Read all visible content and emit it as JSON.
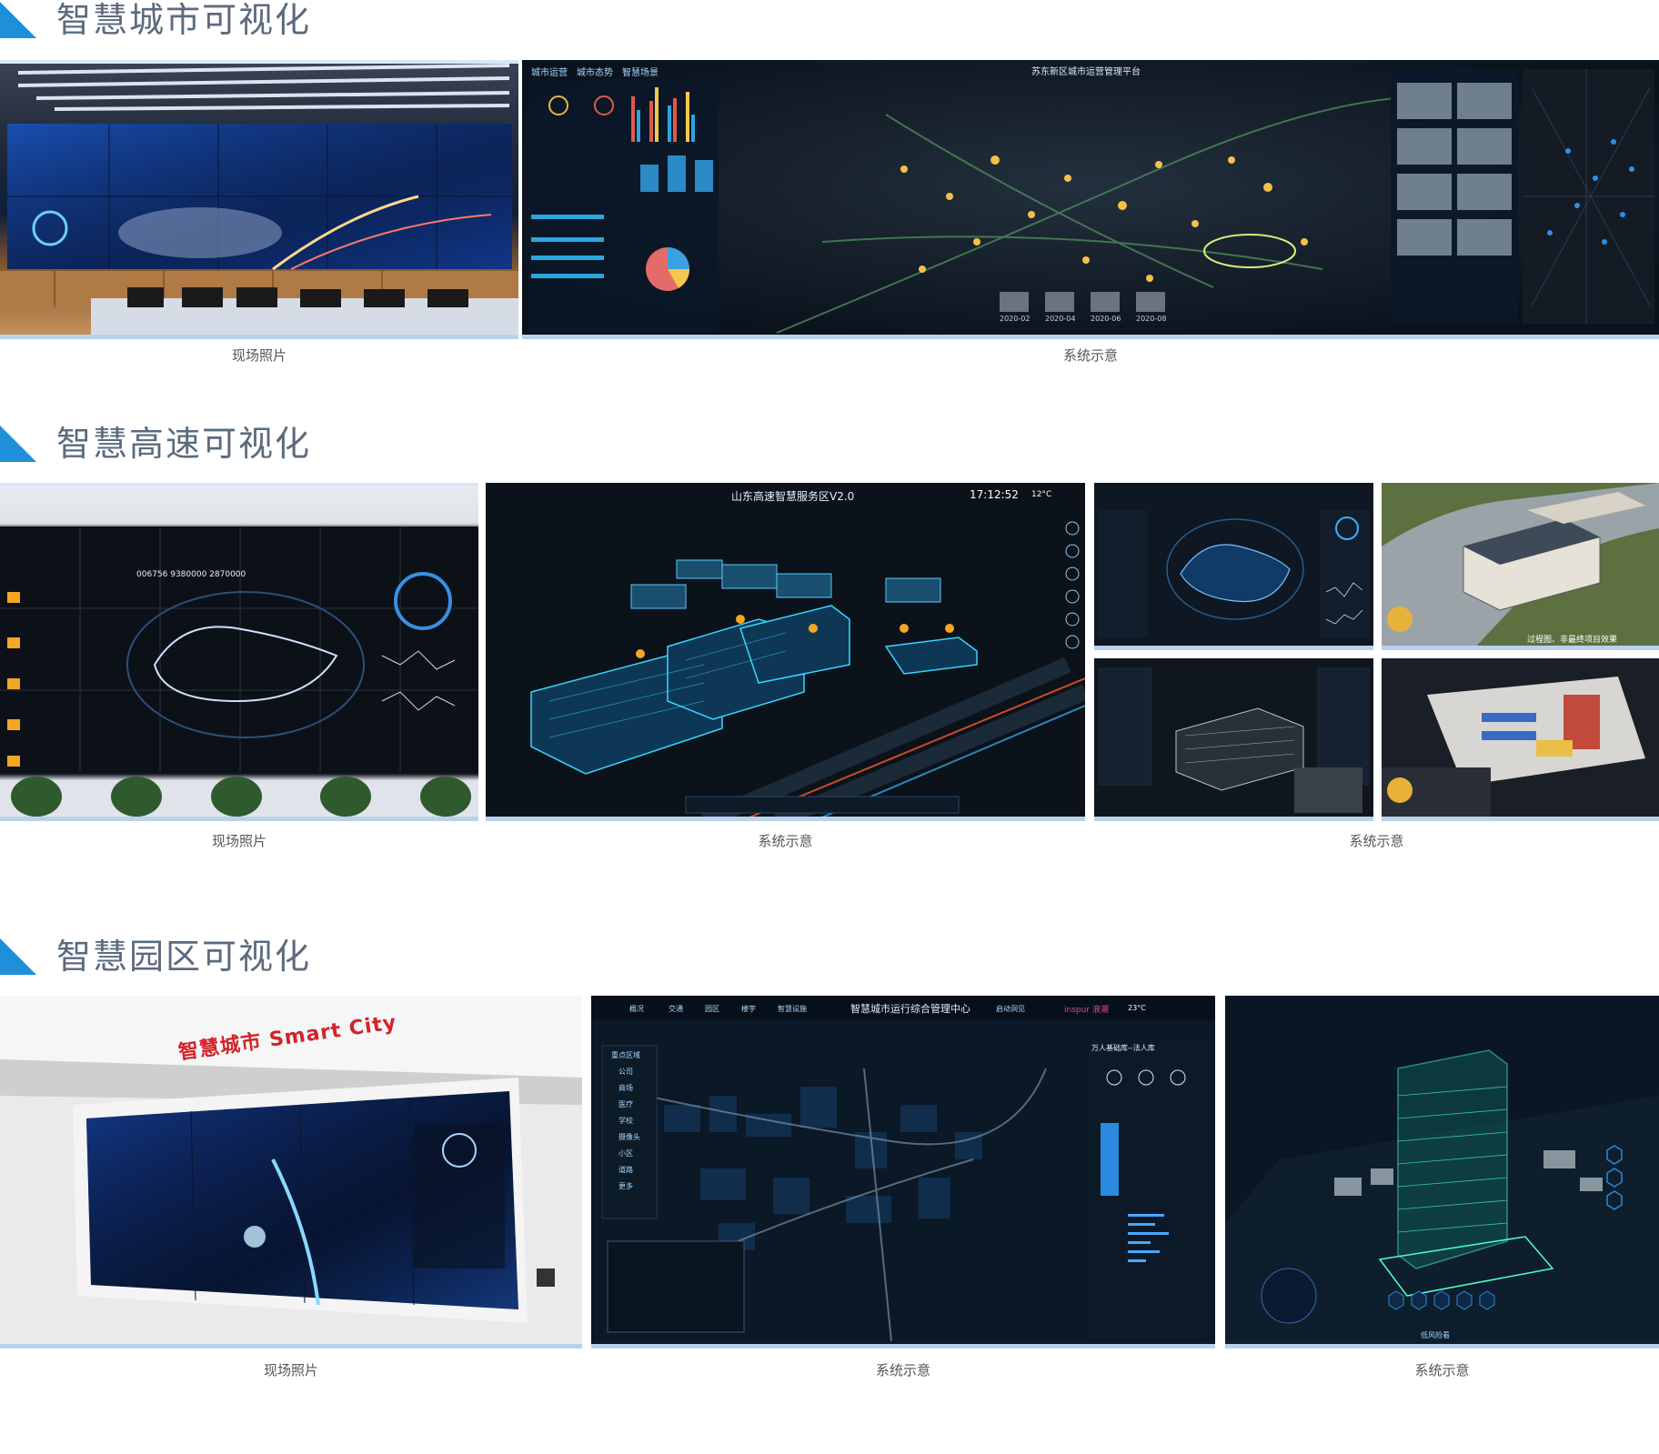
{
  "sections": [
    {
      "title": "智慧城市可视化",
      "captions": [
        "现场照片",
        "系统示意"
      ]
    },
    {
      "title": "智慧高速可视化",
      "captions": [
        "现场照片",
        "系统示意",
        "系统示意"
      ]
    },
    {
      "title": "智慧园区可视化",
      "captions": [
        "现场照片",
        "系统示意",
        "系统示意"
      ]
    }
  ],
  "city_screen": {
    "platform_title": "苏东新区城市运营管理平台",
    "tabs": [
      "城市运营",
      "城市态势",
      "智慧场景"
    ],
    "dates": [
      "2020-02",
      "2020-04",
      "2020-06",
      "2020-08"
    ]
  },
  "highway_screen": {
    "title": "山东高速智慧服务区V2.0",
    "time": "17:12:52",
    "temp": "12°C",
    "counter": "006756   9380000   2870000",
    "banner": "过程图、非最终项目效果"
  },
  "park_screen": {
    "title": "智慧城市运行综合管理中心",
    "tabs": [
      "概况",
      "交通",
      "园区",
      "楼宇",
      "智慧设施",
      "启动洞见"
    ],
    "brand": "inspur 浪潮",
    "temp": "23°C",
    "wall_sign": "智慧城市 Smart City",
    "right_panel": "万人基础库--法人库",
    "left_menu": [
      "重点区域",
      "公司",
      "商场",
      "医疗",
      "学校",
      "摄像头",
      "小区",
      "道路",
      "更多"
    ],
    "bldg_label": "低风险看"
  },
  "colors": {
    "accent": "#1e8fd8",
    "title_gray": "#5a6b7e",
    "panel_dark": "#0b1422",
    "glow": "#f5a623",
    "cyan": "#38d6ff"
  }
}
